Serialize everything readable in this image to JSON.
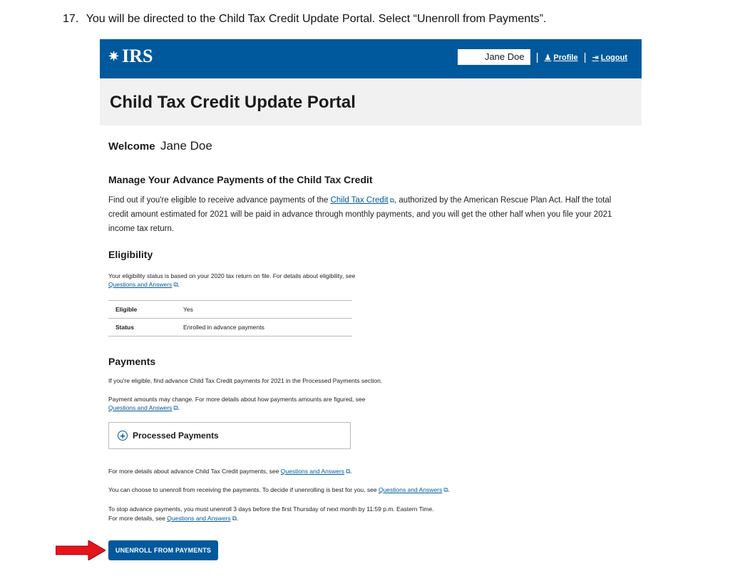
{
  "instruction": {
    "number": "17.",
    "text": "You will be directed to the Child Tax Credit Update Portal.  Select “Unenroll from Payments”."
  },
  "header": {
    "logo_text": "IRS",
    "user_name": "Jane Doe",
    "profile_label": "Profile",
    "logout_label": "Logout",
    "background": "#00599c"
  },
  "page": {
    "title": "Child Tax Credit Update Portal"
  },
  "welcome": {
    "label": "Welcome",
    "name": "Jane Doe"
  },
  "manage": {
    "heading": "Manage Your Advance Payments of the Child Tax Credit",
    "text_before": "Find out if you're eligible to receive advance payments of the ",
    "link": "Child Tax Credit",
    "text_after": ", authorized by the American Rescue Plan Act. Half the total credit amount estimated for 2021 will be paid in advance through monthly payments, and you will get the other half when you file your 2021 income tax return."
  },
  "eligibility": {
    "heading": "Eligibility",
    "text": "Your eligibility status is based on your 2020 tax return on file. For details about eligibility, see",
    "link": "Questions and Answers",
    "rows": [
      {
        "label": "Eligible",
        "value": "Yes"
      },
      {
        "label": "Status",
        "value": "Enrolled in advance payments"
      }
    ]
  },
  "payments": {
    "heading": "Payments",
    "text1": "If you're eligible, find advance Child Tax Credit payments for 2021 in the Processed Payments section.",
    "text2": "Payment amounts may change. For more details about how payments amounts are figured, see",
    "link": "Questions and Answers",
    "accordion_label": "Processed Payments"
  },
  "more": {
    "text1": "For more details about advance Child Tax Credit payments, see ",
    "text2": "You can choose to unenroll from receiving the payments. To decide if unenrolling is best for you, see ",
    "text3a": "To stop advance payments, you must unenroll 3 days before the first Thursday of next month by 11:59 p.m. Eastern Time.",
    "text3b": "For more details, see ",
    "link": "Questions and Answers"
  },
  "unenroll_button": "UNENROLL FROM PAYMENTS",
  "colors": {
    "irs_blue": "#00599c",
    "arrow_red": "#e8141c"
  }
}
